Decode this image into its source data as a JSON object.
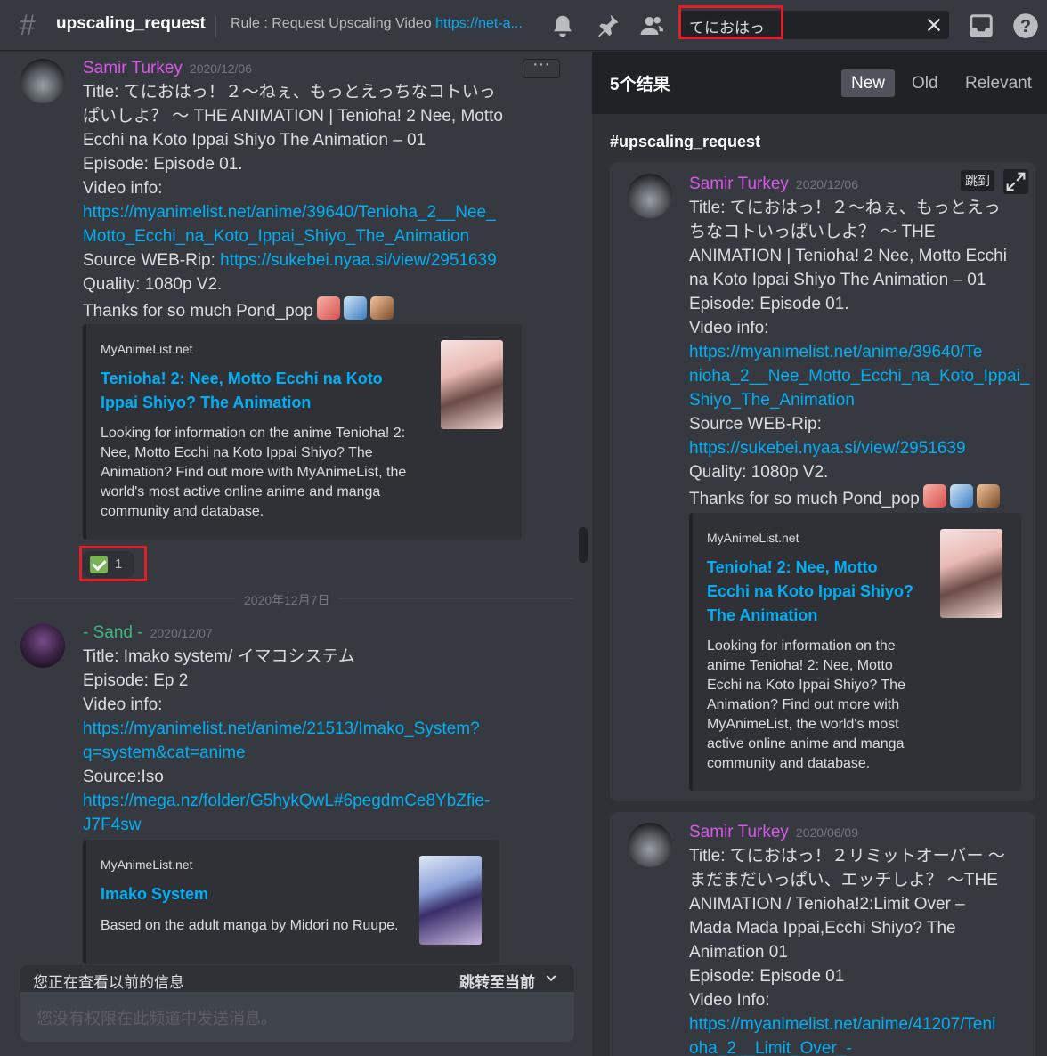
{
  "header": {
    "channel": "upscaling_request",
    "topic_prefix": "Rule : Request Upscaling Video ",
    "topic_link": "https://net-a...",
    "search_value": "てにおはっ",
    "icons": [
      "bell-icon",
      "pin-icon",
      "members-icon",
      "inbox-icon",
      "help-icon"
    ]
  },
  "chat": {
    "more_label": "···",
    "message1": {
      "author": "Samir Turkey",
      "date": "2020/12/06",
      "lines": [
        "Title: てにおはっ！２～ねぇ、もっとえっちなコトいっ",
        "ぱいしよ？ ～ THE ANIMATION | Tenioha! 2 Nee, Motto",
        "Ecchi na Koto Ippai Shiyo The Animation – 01",
        "Episode: Episode 01.",
        "Video info:"
      ],
      "link1a": "https://myanimelist.net/anime/39640/Tenioha_2__Nee_",
      "link1b": "Motto_Ecchi_na_Koto_Ippai_Shiyo_The_Animation",
      "source_prefix": "Source WEB-Rip: ",
      "source_link": "https://sukebei.nyaa.si/view/2951639",
      "quality": "Quality: 1080p V2.",
      "thanks": "Thanks for so much Pond_pop",
      "embed": {
        "provider": "MyAnimeList.net",
        "title1": "Tenioha! 2: Nee, Motto Ecchi na Koto",
        "title2": "Ippai Shiyo? The Animation",
        "desc": [
          "Looking for information on the anime Tenioha! 2:",
          "Nee, Motto Ecchi na Koto Ippai Shiyo? The",
          "Animation? Find out more with MyAnimeList, the",
          "world's most active online anime and manga",
          "community and database."
        ]
      },
      "reaction_count": "1"
    },
    "day_divider": "2020年12月7日",
    "message2": {
      "author": "- Sand -",
      "date": "2020/12/07",
      "lines": [
        "Title: Imako system/ イマコシステム",
        "Episode: Ep 2",
        "Video info:"
      ],
      "link1a": "https://myanimelist.net/anime/21513/Imako_System?",
      "link1b": "q=system&cat=anime",
      "source": "Source:Iso",
      "link2a": "https://mega.nz/folder/G5hykQwL#6pegdmCe8YbZfie-",
      "link2b": "J7F4sw",
      "embed": {
        "provider": "MyAnimeList.net",
        "title": "Imako System",
        "desc": "Based on the adult manga by Midori no Ruupe."
      }
    },
    "older_notice": "您正在查看以前的信息",
    "jump_present": "跳转至当前",
    "compose_placeholder": "您没有权限在此频道中发送消息。"
  },
  "results": {
    "count": "5个结果",
    "sort_options": [
      "New",
      "Old",
      "Relevant"
    ],
    "sort_active": "New",
    "channel": "#upscaling_request",
    "jump_label": "跳到",
    "result1": {
      "author": "Samir Turkey",
      "date": "2020/12/06",
      "lines": [
        "Title: てにおはっ！２～ねぇ、もっとえっ",
        "ちなコトいっぱいしよ？ ～ THE",
        "ANIMATION | Tenioha! 2 Nee, Motto Ecchi",
        "na Koto Ippai Shiyo The Animation – 01",
        "Episode: Episode 01.",
        "Video info:"
      ],
      "link_lines": [
        "https://myanimelist.net/anime/39640/Te",
        "nioha_2__Nee_Motto_Ecchi_na_Koto_Ippai_",
        "Shiyo_The_Animation"
      ],
      "source": "Source WEB-Rip:",
      "source_link": "https://sukebei.nyaa.si/view/2951639",
      "quality": "Quality: 1080p V2.",
      "thanks": "Thanks for so much Pond_pop",
      "embed": {
        "provider": "MyAnimeList.net",
        "title": [
          "Tenioha! 2: Nee, Motto",
          "Ecchi na Koto Ippai Shiyo?",
          "The Animation"
        ],
        "desc": [
          "Looking for information on the",
          "anime Tenioha! 2: Nee, Motto",
          "Ecchi na Koto Ippai Shiyo? The",
          "Animation? Find out more with",
          "MyAnimeList, the world's most",
          "active online anime and manga",
          "community and database."
        ]
      }
    },
    "result2": {
      "author": "Samir Turkey",
      "date": "2020/06/09",
      "lines": [
        "Title: てにおはっ！２リミットオーバー ～",
        "まだまだいっぱい、エッチしよ？ ～THE",
        "ANIMATION / Tenioha!2:Limit Over –",
        "Mada Mada Ippai,Ecchi Shiyo? The",
        "Animation 01",
        "Episode: Episode 01",
        "Video Info:"
      ],
      "link_lines": [
        "https://myanimelist.net/anime/41207/Teni",
        "oha_2__Limit_Over_-"
      ]
    }
  },
  "colors": {
    "bg": "#36393f",
    "panel": "#2f3136",
    "dark": "#202225",
    "link": "#00aff4",
    "author_pink": "#d858ea",
    "author_green": "#43b581",
    "highlight": "#e01f2a"
  }
}
